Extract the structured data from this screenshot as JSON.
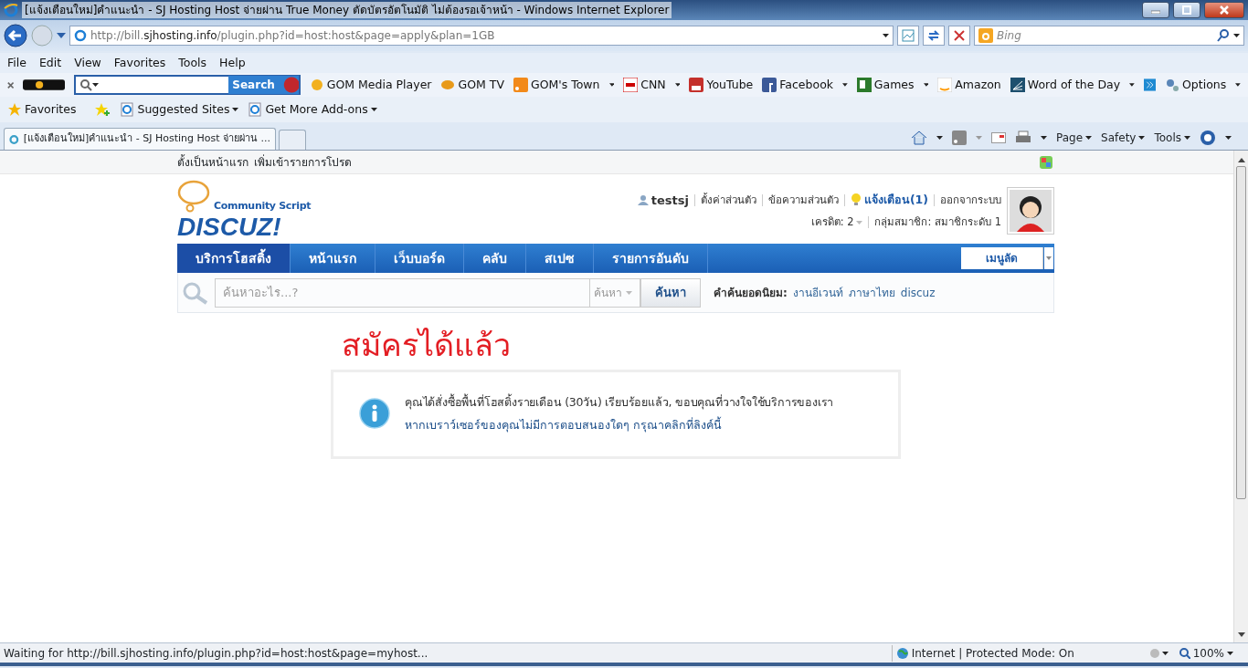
{
  "window": {
    "title": "[แจ้งเตือนใหม่]คำแนะนำ - SJ Hosting Host จ่ายผ่าน True Money ตัดบัตรอัตโนมัติ ไม่ต้องรอเจ้าหน้า - Windows Internet Explorer"
  },
  "address_bar": {
    "url": "http://bill.**sjhosting.info**/plugin.php?id=host:host&page=apply&plan=1GB"
  },
  "search_box": {
    "placeholder": "Bing"
  },
  "menu": [
    "File",
    "Edit",
    "View",
    "Favorites",
    "Tools",
    "Help"
  ],
  "gom_toolbar": {
    "search_button": "Search",
    "links": [
      {
        "label": "GOM Media Player",
        "dropdown": false
      },
      {
        "label": "GOM TV",
        "dropdown": false
      },
      {
        "label": "GOM's Town",
        "dropdown": true
      },
      {
        "label": "CNN",
        "dropdown": true
      },
      {
        "label": "YouTube",
        "dropdown": false
      },
      {
        "label": "Facebook",
        "dropdown": true
      },
      {
        "label": "Games",
        "dropdown": true
      },
      {
        "label": "Amazon",
        "dropdown": false
      },
      {
        "label": "Word of the Day",
        "dropdown": true
      }
    ],
    "options": "Options"
  },
  "favorites_bar": {
    "favorites": "Favorites",
    "items": [
      "Suggested Sites",
      "Get More Add-ons"
    ]
  },
  "tabs": [
    {
      "label": "[แจ้งเตือนใหม่]คำแนะนำ - SJ Hosting Host จ่ายผ่าน ...",
      "selected": true
    }
  ],
  "command_bar": [
    "Page",
    "Safety",
    "Tools"
  ],
  "page": {
    "top_links": [
      "ตั้งเป็นหน้าแรก",
      "เพิ่มเข้ารายการโปรด"
    ],
    "logo": {
      "tagline": "Community Script",
      "name": "DISCUZ!"
    },
    "user_links": [
      {
        "label": "testsj",
        "kind": "user"
      },
      {
        "label": "ตั้งค่าส่วนตัว",
        "kind": "link"
      },
      {
        "label": "ข้อความส่วนตัว",
        "kind": "link"
      },
      {
        "label": "แจ้งเตือน(1)",
        "kind": "notice"
      },
      {
        "label": "ออกจากระบบ",
        "kind": "link"
      }
    ],
    "credit": "เครดิต: 2",
    "group": "กลุ่มสมาชิก: สมาชิกระดับ 1",
    "nav": [
      {
        "label": "บริการโฮสติ้ง",
        "selected": true
      },
      {
        "label": "หน้าแรก",
        "selected": false
      },
      {
        "label": "เว็บบอร์ด",
        "selected": false
      },
      {
        "label": "คลับ",
        "selected": false
      },
      {
        "label": "สเปซ",
        "selected": false
      },
      {
        "label": "รายการอันดับ",
        "selected": false
      }
    ],
    "quick_menu": "เมนูลัด",
    "search": {
      "placeholder": "ค้นหาอะไร...?",
      "type": "ค้นหา",
      "button": "ค้นหา",
      "hot_label": "คำค้นยอดนิยม:",
      "hot": [
        "งานอีเวนท์",
        "ภาษาไทย",
        "discuz"
      ]
    },
    "heading": "สมัครได้แล้ว",
    "message": "คุณได้สั่งซื้อพื้นที่โฮสติ้งรายเดือน (30วัน) เรียบร้อยแล้ว, ขอบคุณที่วางใจใช้บริการของเรา",
    "message_link": "หากเบราว์เซอร์ของคุณไม่มีการตอบสนองใดๆ กรุณาคลิกที่ลิงค์นี้"
  },
  "status_bar": {
    "text": "Waiting for http://bill.sjhosting.info/plugin.php?id=host:host&page=myhost...",
    "zone": "Internet | Protected Mode: On",
    "zoom": "100%"
  }
}
